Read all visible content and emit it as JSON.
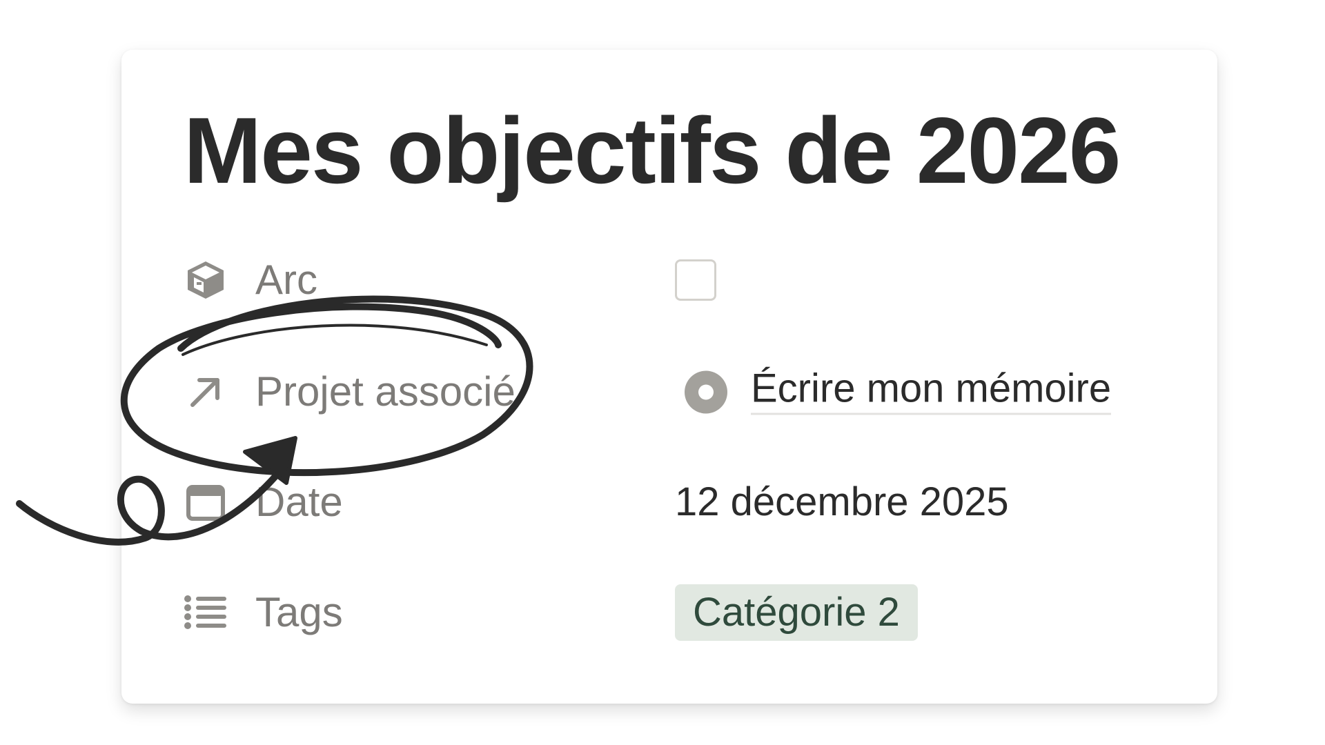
{
  "page": {
    "title": "Mes objectifs de 2026"
  },
  "properties": [
    {
      "icon": "archive-box-icon",
      "label": "Arc",
      "value_type": "checkbox",
      "checked": false
    },
    {
      "icon": "arrow-up-right-icon",
      "label": "Projet associé",
      "value_type": "relation",
      "value": "Écrire mon mémoire",
      "status_icon": "in-progress-status-icon"
    },
    {
      "icon": "calendar-icon",
      "label": "Date",
      "value_type": "date",
      "value": "12 décembre 2025"
    },
    {
      "icon": "bulleted-list-icon",
      "label": "Tags",
      "value_type": "tag",
      "value": "Catégorie 2",
      "tag_color": "#e1e8e1",
      "tag_text_color": "#2f4a3c"
    }
  ],
  "annotation": {
    "shape": "hand-drawn circle with arrow",
    "target": "Projet associé",
    "ink_color": "#2a2a2a"
  }
}
